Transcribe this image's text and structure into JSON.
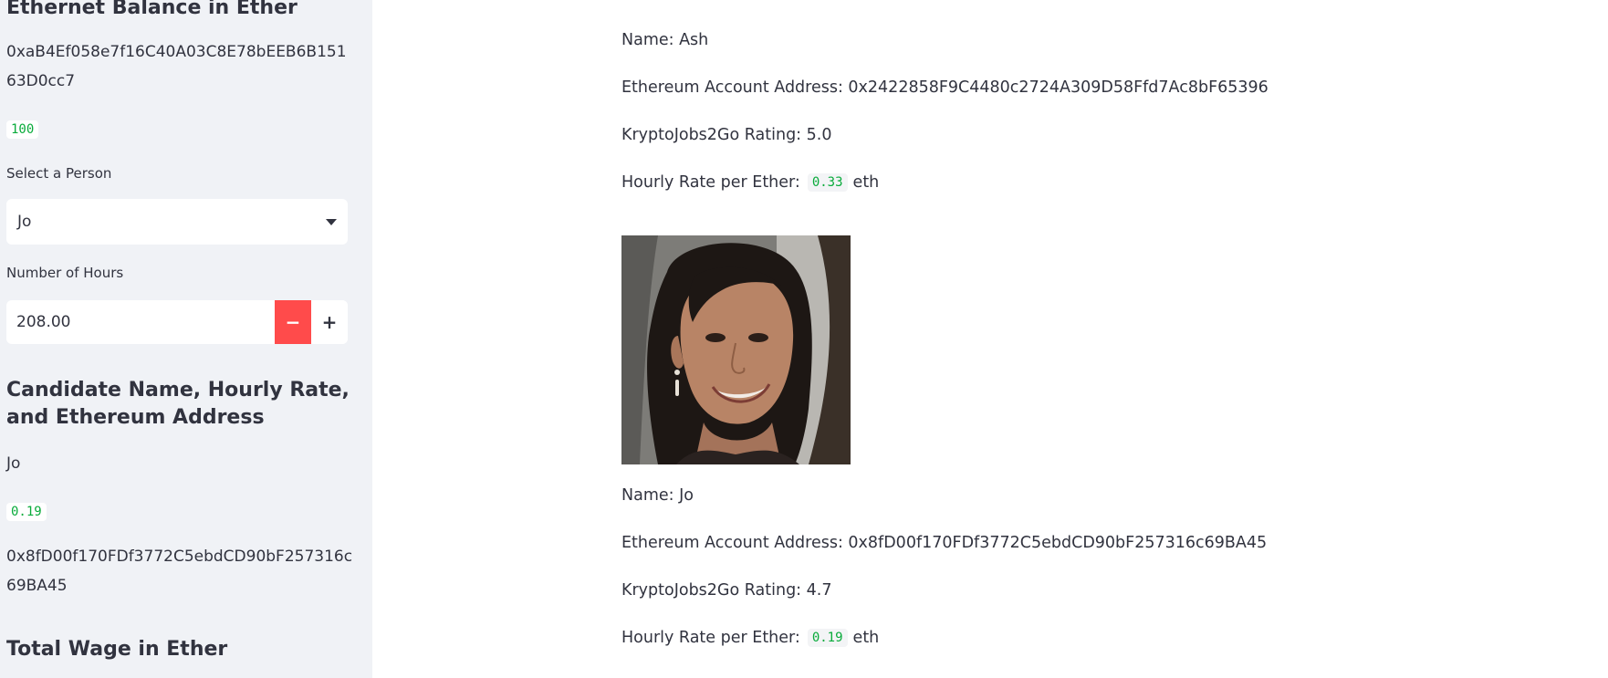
{
  "sidebar": {
    "balance_heading": "Ethernet Balance in Ether",
    "account_address": "0xaB4Ef058e7f16C40A03C8E78bEEB6B15163D0cc7",
    "balance_value": "100",
    "select_label": "Select a Person",
    "select_value": "Jo",
    "hours_label": "Number of Hours",
    "hours_value": "208.00",
    "minus_label": "−",
    "plus_label": "+",
    "candidate_heading": "Candidate Name, Hourly Rate, and Ethereum Address",
    "candidate_name": "Jo",
    "candidate_rate": "0.19",
    "candidate_address": "0x8fD00f170FDf3772C5ebdCD90bF257316c69BA45",
    "total_heading": "Total Wage in Ether"
  },
  "main": {
    "prev_candidate": {
      "name_line": "Name: Ash",
      "address_line": "Ethereum Account Address: 0x2422858F9C4480c2724A309D58Ffd7Ac8bF65396",
      "rating_line": "KryptoJobs2Go Rating: 5.0",
      "rate_prefix": "Hourly Rate per Ether:",
      "rate_value": "0.33",
      "rate_unit": "eth"
    },
    "candidate": {
      "name_line": "Name: Jo",
      "address_line": "Ethereum Account Address: 0x8fD00f170FDf3772C5ebdCD90bF257316c69BA45",
      "rating_line": "KryptoJobs2Go Rating: 4.7",
      "rate_prefix": "Hourly Rate per Ether:",
      "rate_value": "0.19",
      "rate_unit": "eth"
    }
  },
  "colors": {
    "sidebar_bg": "#f0f2f6",
    "accent_red": "#ff4b4b",
    "code_green": "#09ab3b",
    "text": "#31333f"
  },
  "icons": {
    "select_chevron": "chevron-down-icon"
  }
}
